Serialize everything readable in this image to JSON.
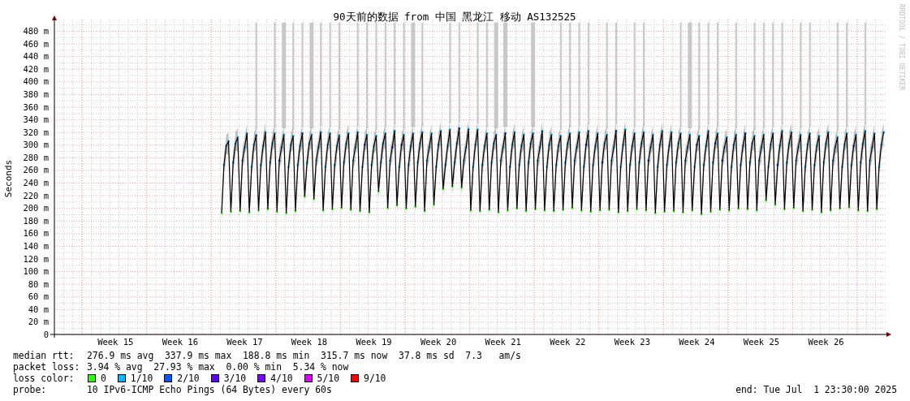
{
  "chart": {
    "title": "90天前的数据 from 中国 黑龙江 移动 AS132525",
    "side_label": "RRDTOOL / TOBI OETIKER",
    "chart_data": {
      "type": "line",
      "grid": true,
      "ylabel": "Seconds",
      "ylim": [
        0,
        480
      ],
      "yticks": [
        {
          "value": 0,
          "label": "0"
        },
        {
          "value": 20,
          "label": "20 m"
        },
        {
          "value": 40,
          "label": "40 m"
        },
        {
          "value": 60,
          "label": "60 m"
        },
        {
          "value": 80,
          "label": "80 m"
        },
        {
          "value": 100,
          "label": "100 m"
        },
        {
          "value": 120,
          "label": "120 m"
        },
        {
          "value": 140,
          "label": "140 m"
        },
        {
          "value": 160,
          "label": "160 m"
        },
        {
          "value": 180,
          "label": "180 m"
        },
        {
          "value": 200,
          "label": "200 m"
        },
        {
          "value": 220,
          "label": "220 m"
        },
        {
          "value": 240,
          "label": "240 m"
        },
        {
          "value": 260,
          "label": "260 m"
        },
        {
          "value": 280,
          "label": "280 m"
        },
        {
          "value": 300,
          "label": "300 m"
        },
        {
          "value": 320,
          "label": "320 m"
        },
        {
          "value": 340,
          "label": "340 m"
        },
        {
          "value": 360,
          "label": "360 m"
        },
        {
          "value": 380,
          "label": "380 m"
        },
        {
          "value": 400,
          "label": "400 m"
        },
        {
          "value": 420,
          "label": "420 m"
        },
        {
          "value": 440,
          "label": "440 m"
        },
        {
          "value": 460,
          "label": "460 m"
        },
        {
          "value": 480,
          "label": "480 m"
        }
      ],
      "categories": [
        null,
        null,
        null,
        null,
        null,
        null,
        null,
        null,
        null,
        null,
        null,
        null,
        null,
        null,
        null,
        null,
        null,
        null,
        null,
        null,
        null,
        null,
        null,
        null,
        null,
        null,
        "Week 15",
        null,
        null,
        null,
        null,
        null,
        null,
        null,
        null,
        null,
        null,
        null,
        null,
        null,
        null,
        null,
        null,
        null,
        null,
        null,
        null,
        null,
        null,
        null,
        null,
        null,
        null,
        null,
        "Week 16",
        null,
        null,
        null,
        null,
        null,
        null,
        null,
        null,
        null,
        null,
        null,
        null,
        null,
        null,
        null,
        null,
        null,
        null,
        null,
        null,
        null,
        null,
        null,
        null,
        null,
        null,
        null,
        "Week 17",
        null,
        null,
        null,
        null,
        null,
        null,
        null,
        null,
        null,
        null,
        null,
        null,
        null,
        null,
        null,
        null,
        null,
        null,
        null,
        null,
        null,
        null,
        null,
        null,
        null,
        null,
        null,
        "Week 18",
        null,
        null,
        null,
        null,
        null,
        null,
        null,
        null,
        null,
        null,
        null,
        null,
        null,
        null,
        null,
        null,
        null,
        null,
        null,
        null,
        null,
        null,
        null,
        null,
        null,
        null,
        null,
        "Week 19",
        null,
        null,
        null,
        null,
        null,
        null,
        null,
        null,
        null,
        null,
        null,
        null,
        null,
        null,
        null,
        null,
        null,
        null,
        null,
        null,
        null,
        null,
        null,
        null,
        null,
        null,
        null,
        "Week 20",
        null,
        null,
        null,
        null,
        null,
        null,
        null,
        null,
        null,
        null,
        null,
        null,
        null,
        null,
        null,
        null,
        null,
        null,
        null,
        null,
        null,
        null,
        null,
        null,
        null,
        null,
        null,
        "Week 21",
        null,
        null,
        null,
        null,
        null,
        null,
        null,
        null,
        null,
        null,
        null,
        null,
        null,
        null,
        null,
        null,
        null,
        null,
        null,
        null,
        null,
        null,
        null,
        null,
        null,
        null,
        null,
        "Week 22",
        null,
        null,
        null,
        null,
        null,
        null,
        null,
        null,
        null,
        null,
        null,
        null,
        null,
        null,
        null,
        null,
        null,
        null,
        null,
        null,
        null,
        null,
        null,
        null,
        null,
        null,
        null,
        "Week 23",
        null,
        null,
        null,
        null,
        null,
        null,
        null,
        null,
        null,
        null,
        null,
        null,
        null,
        null,
        null,
        null,
        null,
        null,
        null,
        null,
        null,
        null,
        null,
        null,
        null,
        null,
        null,
        "Week 24",
        null,
        null,
        null,
        null,
        null,
        null,
        null,
        null,
        null,
        null,
        null,
        null,
        null,
        null,
        null,
        null,
        null,
        null,
        null,
        null,
        null,
        null,
        null,
        null,
        null,
        null,
        null,
        "Week 25",
        null,
        null,
        null,
        null,
        null,
        null,
        null,
        null,
        null,
        null,
        null,
        null,
        null,
        null,
        null,
        null,
        null,
        null,
        null,
        null,
        null,
        null,
        null,
        null,
        null,
        null,
        null,
        "Week 26",
        null,
        null,
        null,
        null,
        null,
        null,
        null,
        null,
        null,
        null,
        null,
        null,
        null,
        null,
        null,
        null,
        null,
        null,
        null,
        null,
        null,
        null,
        null,
        null,
        null
      ],
      "series": [
        {
          "color": "#000000",
          "marker": "square",
          "values": [
            null,
            null,
            null,
            null,
            null,
            null,
            null,
            null,
            null,
            null,
            null,
            null,
            null,
            null,
            null,
            null,
            null,
            null,
            null,
            null,
            null,
            null,
            null,
            null,
            null,
            null,
            null,
            null,
            null,
            null,
            null,
            null,
            null,
            null,
            null,
            null,
            null,
            null,
            null,
            null,
            null,
            null,
            null,
            null,
            null,
            null,
            null,
            null,
            null,
            null,
            null,
            null,
            null,
            null,
            null,
            null,
            null,
            null,
            null,
            null,
            null,
            null,
            null,
            null,
            null,
            null,
            null,
            null,
            null,
            null,
            null,
            null,
            192,
            268,
            298,
            305,
            194,
            272,
            302,
            312,
            195,
            275,
            296,
            318,
            193,
            265,
            300,
            315,
            196,
            268,
            298,
            320,
            198,
            272,
            302,
            318,
            194,
            275,
            296,
            316,
            192,
            265,
            300,
            314,
            195,
            268,
            298,
            318,
            218,
            272,
            302,
            316,
            214,
            275,
            296,
            320,
            196,
            265,
            300,
            318,
            198,
            268,
            298,
            315,
            200,
            272,
            302,
            318,
            197,
            275,
            296,
            320,
            195,
            265,
            300,
            316,
            193,
            268,
            298,
            314,
            226,
            272,
            302,
            318,
            200,
            275,
            296,
            322,
            204,
            265,
            300,
            316,
            199,
            268,
            298,
            318,
            202,
            272,
            302,
            320,
            195,
            275,
            296,
            318,
            205,
            265,
            300,
            322,
            230,
            268,
            298,
            324,
            234,
            272,
            302,
            326,
            232,
            275,
            296,
            325,
            196,
            265,
            300,
            324,
            195,
            268,
            298,
            318,
            197,
            272,
            302,
            316,
            193,
            275,
            296,
            318,
            196,
            265,
            300,
            320,
            199,
            268,
            298,
            316,
            195,
            272,
            302,
            318,
            198,
            275,
            296,
            322,
            196,
            265,
            300,
            316,
            195,
            268,
            298,
            314,
            197,
            272,
            302,
            318,
            200,
            275,
            296,
            320,
            196,
            265,
            300,
            322,
            194,
            268,
            298,
            318,
            196,
            272,
            302,
            316,
            197,
            275,
            296,
            322,
            193,
            265,
            300,
            324,
            195,
            268,
            298,
            318,
            198,
            272,
            302,
            320,
            196,
            275,
            296,
            316,
            192,
            265,
            300,
            322,
            194,
            268,
            298,
            320,
            195,
            272,
            302,
            318,
            193,
            275,
            296,
            316,
            196,
            265,
            300,
            314,
            190,
            268,
            298,
            322,
            194,
            272,
            302,
            318,
            197,
            275,
            296,
            312,
            196,
            265,
            300,
            316,
            199,
            268,
            298,
            318,
            198,
            272,
            302,
            314,
            196,
            275,
            296,
            316,
            212,
            265,
            300,
            318,
            205,
            268,
            298,
            322,
            198,
            272,
            302,
            320,
            200,
            275,
            296,
            316,
            195,
            265,
            300,
            318,
            197,
            268,
            298,
            314,
            193,
            272,
            302,
            320,
            196,
            275,
            296,
            312,
            199,
            265,
            300,
            318,
            201,
            268,
            298,
            316,
            196,
            272,
            302,
            322,
            195,
            275,
            296,
            318,
            198,
            265,
            300,
            320
          ]
        }
      ]
    }
  },
  "stats": [
    {
      "label": "median rtt:",
      "value": "276.9 ms avg  337.9 ms max  188.8 ms min  315.7 ms now  37.8 ms sd  7.3   am/s"
    },
    {
      "label": "packet loss:",
      "value": "3.94 % avg  27.93 % max  0.00 % min  5.34 % now"
    }
  ],
  "loss_colors": {
    "label": "loss color:",
    "items": [
      {
        "label": "0",
        "color": "#26ff00"
      },
      {
        "label": "1/10",
        "color": "#00b8ff"
      },
      {
        "label": "2/10",
        "color": "#0059ff"
      },
      {
        "label": "3/10",
        "color": "#5e00ff"
      },
      {
        "label": "4/10",
        "color": "#7e00ff"
      },
      {
        "label": "5/10",
        "color": "#dd00ff"
      },
      {
        "label": "9/10",
        "color": "#ff0000"
      }
    ]
  },
  "probe": {
    "label": "probe:",
    "value": "10 IPv6-ICMP Echo Pings (64 Bytes) every 60s"
  },
  "end": "end: Tue Jul  1 23:30:00 2025"
}
